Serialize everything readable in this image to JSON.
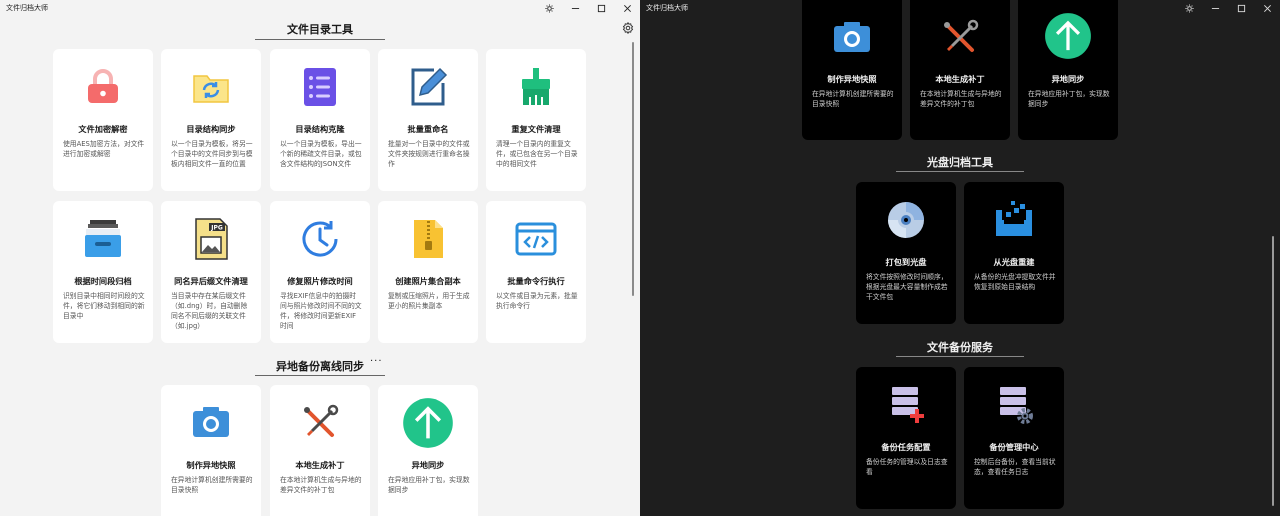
{
  "light": {
    "title": "文件归档大师",
    "section1_title": "文件目录工具",
    "section2_title": "异地备份离线同步",
    "more_label": "···",
    "cards_row1": [
      {
        "title": "文件加密解密",
        "desc": "使用AES加密方法，对文件进行加密或解密",
        "icon": "lock-icon"
      },
      {
        "title": "目录结构同步",
        "desc": "以一个目录为模板，将另一个目录中的文件同步到与模板内相同文件一直的位置",
        "icon": "folder-sync-icon"
      },
      {
        "title": "目录结构克隆",
        "desc": "以一个目录为模板，导出一个新的稀疏文件目录，或包含文件结构的JSON文件",
        "icon": "list-icon"
      },
      {
        "title": "批量重命名",
        "desc": "批量对一个目录中的文件或文件夹按规则进行重命名操作",
        "icon": "pencil-icon"
      },
      {
        "title": "重复文件清理",
        "desc": "清理一个目录内的重复文件，或已包含在另一个目录中的相同文件",
        "icon": "cleaner-icon"
      }
    ],
    "cards_row2": [
      {
        "title": "根据时间段归档",
        "desc": "识别目录中相同时间段的文件，将它们移动到相同的新目录中",
        "icon": "archive-drawer-icon"
      },
      {
        "title": "同名异后缀文件清理",
        "desc": "当目录中存在某后缀文件（如.dng）时，自动删除同名不同后缀的关联文件（如.jpg）",
        "icon": "jpg-file-icon"
      },
      {
        "title": "修复照片修改时间",
        "desc": "寻找EXIF信息中的拍摄时间与照片修改时间不同的文件，将修改时间更新EXIF时间",
        "icon": "clock-icon"
      },
      {
        "title": "创建照片集合副本",
        "desc": "复制或压缩照片，用于生成更小的照片集副本",
        "icon": "zip-file-icon"
      },
      {
        "title": "批量命令行执行",
        "desc": "以文件或目录为元素，批量执行命令行",
        "icon": "code-window-icon"
      }
    ],
    "cards_row3": [
      {
        "title": "制作异地快照",
        "desc": "在异地计算机创建所需要的目录快照",
        "icon": "camera-icon"
      },
      {
        "title": "本地生成补丁",
        "desc": "在本地计算机生成与异地的差异文件的补丁包",
        "icon": "tools-icon"
      },
      {
        "title": "异地同步",
        "desc": "在异地应用补丁包，实现数据同步",
        "icon": "upload-arrow-icon"
      }
    ]
  },
  "dark": {
    "title": "文件归档大师",
    "cards_top": [
      {
        "title": "制作异地快照",
        "desc": "在异地计算机创建所需要的目录快照",
        "icon": "camera-icon"
      },
      {
        "title": "本地生成补丁",
        "desc": "在本地计算机生成与异地的差异文件的补丁包",
        "icon": "tools-icon"
      },
      {
        "title": "异地同步",
        "desc": "在异地应用补丁包，实现数据同步",
        "icon": "upload-arrow-icon"
      }
    ],
    "section_disc_title": "光盘归档工具",
    "cards_disc": [
      {
        "title": "打包到光盘",
        "desc": "将文件按照修改时间顺序，根据光盘最大容量制作成若干文件包",
        "icon": "disc-icon"
      },
      {
        "title": "从光盘重建",
        "desc": "从备份的光盘冲提取文件并恢复到原始目录结构",
        "icon": "rebuild-icon"
      }
    ],
    "section_backup_title": "文件备份服务",
    "cards_backup": [
      {
        "title": "备份任务配置",
        "desc": "备份任务的管理以及日志查看",
        "icon": "server-add-icon"
      },
      {
        "title": "备份管理中心",
        "desc": "控制后台备份，查看当前状态，查看任务日志",
        "icon": "server-gear-icon"
      }
    ]
  }
}
